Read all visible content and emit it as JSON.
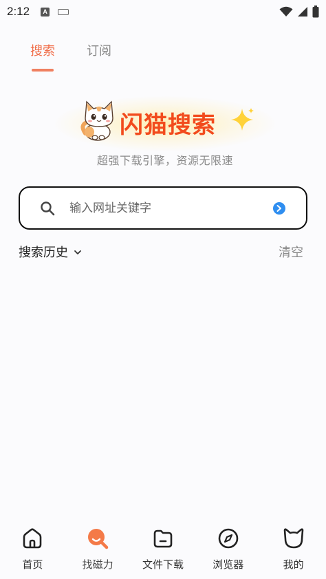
{
  "status_bar": {
    "time": "2:12",
    "a_icon_letter": "A"
  },
  "tabs": [
    {
      "label": "搜索",
      "active": true
    },
    {
      "label": "订阅",
      "active": false
    }
  ],
  "brand": {
    "title": "闪猫搜索",
    "subtitle": "超强下载引擎，资源无限速"
  },
  "search": {
    "placeholder": "输入网址关键字",
    "value": ""
  },
  "history": {
    "title": "搜索历史",
    "clear_label": "清空"
  },
  "bottom_nav": [
    {
      "label": "首页",
      "icon": "home-icon"
    },
    {
      "label": "找磁力",
      "icon": "magnet-search-icon",
      "active": true
    },
    {
      "label": "文件下载",
      "icon": "folder-icon"
    },
    {
      "label": "浏览器",
      "icon": "compass-icon"
    },
    {
      "label": "我的",
      "icon": "cat-head-icon"
    }
  ],
  "colors": {
    "accent": "#f06a45",
    "brand_red": "#f24b1d",
    "go_blue": "#2f8ef0"
  }
}
